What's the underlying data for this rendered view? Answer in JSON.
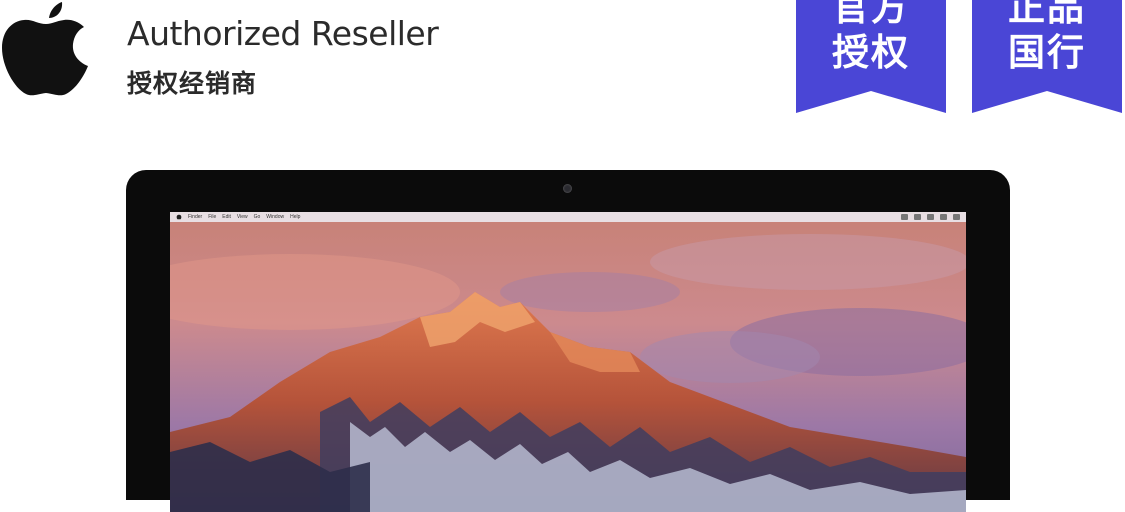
{
  "brand": {
    "title": "Authorized Reseller",
    "subtitle": "授权经销商",
    "logo_icon": "apple-logo-icon",
    "text_color": "#2b2b2b"
  },
  "badges": [
    {
      "line1": "官方",
      "line2": "授权",
      "color": "#4a46d6"
    },
    {
      "line1": "正品",
      "line2": "国行",
      "color": "#4a46d6"
    }
  ],
  "product": {
    "screen": {
      "menu_items": [
        "Finder",
        "File",
        "Edit",
        "View",
        "Go",
        "Window",
        "Help"
      ]
    }
  }
}
